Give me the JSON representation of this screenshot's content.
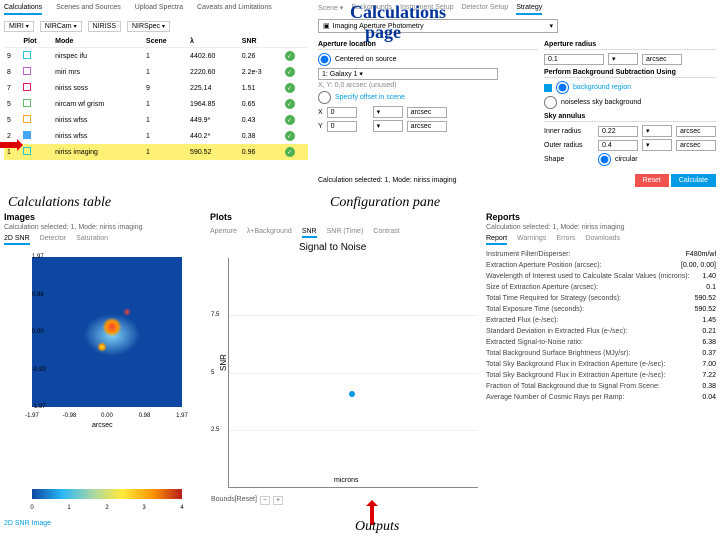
{
  "annotations": {
    "title": "Calculations",
    "page": "page",
    "calc_table": "Calculations table",
    "config": "Configuration pane",
    "outputs": "Outputs"
  },
  "calc_tabs": [
    "Calculations",
    "Scenes and Sources",
    "Upload Spectra",
    "Caveats and Limitations"
  ],
  "tools": {
    "miri": "MIRI",
    "nircam": "NIRCam",
    "niriss": "NIRISS",
    "nirspec": "NIRSpec"
  },
  "calc_table": {
    "headers": [
      "",
      "Plot",
      "Mode",
      "Scene",
      "λ",
      "SNR",
      ""
    ],
    "rows": [
      {
        "id": "9",
        "mode": "nirspec ifu",
        "scene": "1",
        "lambda": "4402.60",
        "snr": "0.26"
      },
      {
        "id": "8",
        "mode": "miri mrs",
        "scene": "1",
        "lambda": "2220.60",
        "snr": "2.2e-3"
      },
      {
        "id": "7",
        "mode": "niriss soss",
        "scene": "9",
        "lambda": "225.14",
        "snr": "1.51"
      },
      {
        "id": "5",
        "mode": "nircam wf grism",
        "scene": "1",
        "lambda": "1964.85",
        "snr": "0.65"
      },
      {
        "id": "5",
        "mode": "niriss wfss",
        "scene": "1",
        "lambda": "449.9*",
        "snr": "0.43"
      },
      {
        "id": "2",
        "mode": "niriss wfss",
        "scene": "1",
        "lambda": "440.2*",
        "snr": "0.38"
      },
      {
        "id": "1",
        "mode": "niriss imaging",
        "scene": "1",
        "lambda": "590.52",
        "snr": "0.96",
        "selected": true
      }
    ]
  },
  "config_tabs": [
    "Scene ▾",
    "Backgrounds",
    "Instrument Setup",
    "Detector Setup",
    "Strategy"
  ],
  "config": {
    "scene_mode": "Imaging Aperture Photometry",
    "aperture_loc": "Aperture location",
    "centered": "Centered on source",
    "target": "1: Galaxy 1",
    "xy": "X, Y: 0,0 arcsec (unused)",
    "spec_offset": "Specify offset in scene",
    "x_lab": "X",
    "y_lab": "Y",
    "x_val": "0",
    "y_val": "0",
    "arcsec": "arcsec",
    "ap_radius": "Aperture radius",
    "ap_radius_val": "0.1",
    "bg_sub": "Perform Background Subtraction Using",
    "bg_region": "background region",
    "noiseless": "noiseless sky background",
    "sky_ann": "Sky annulus",
    "inner": "Inner radius",
    "inner_val": "0.22",
    "outer": "Outer radius",
    "outer_val": "0.4",
    "shape": "Shape",
    "shape_val": "circular",
    "footer_sel": "Calculation selected: 1, Mode: niriss imaging",
    "reset": "Reset",
    "calculate": "Calculate"
  },
  "images": {
    "title": "Images",
    "sub": "Calculation selected: 1, Mode: niriss imaging",
    "tabs": [
      "2D SNR",
      "Detector",
      "Saturation"
    ],
    "caption": "2D SNR Image",
    "yticks": [
      "1.97",
      "0.98",
      "0.00",
      "-0.93",
      "-1.97"
    ],
    "xticks": [
      "-1.97",
      "-0.98",
      "0.00",
      "0.98",
      "1.97"
    ],
    "ylabel": "arcsec",
    "xlabel": "arcsec",
    "cbticks": [
      "0",
      "1",
      "2",
      "3",
      "4"
    ]
  },
  "plots": {
    "title": "Plots",
    "tabs": [
      "Aperture",
      "λ+Background",
      "SNR",
      "SNR (Time)",
      "Contrast"
    ],
    "chart_title": "Signal to Noise",
    "ylabel": "SNR",
    "yticks": [
      "7.5",
      "5",
      "2.5"
    ],
    "bounds": "Bounds[Reset]",
    "microns": "microns"
  },
  "reports": {
    "title": "Reports",
    "sub": "Calculation selected: 1, Mode: niriss imaging",
    "tabs": [
      "Report",
      "Warnings",
      "Errors",
      "Downloads"
    ],
    "rows": [
      {
        "lab": "Instrument Filter/Disperser:",
        "val": "F480m/wl"
      },
      {
        "lab": "Extraction Aperture Position (arcsec):",
        "val": "[0.00, 0.00]"
      },
      {
        "lab": "Wavelength of Interest used to Calculate Scalar Values (microns):",
        "val": "1.40"
      },
      {
        "lab": "Size of Extraction Aperture (arcsec):",
        "val": "0.1"
      },
      {
        "lab": "Total Time Required for Strategy (seconds):",
        "val": "590.52"
      },
      {
        "lab": "Total Exposure Time (seconds):",
        "val": "590.52"
      },
      {
        "lab": "Extracted Flux (e-/sec):",
        "val": "1.45"
      },
      {
        "lab": "Standard Deviation in Extracted Flux (e-/sec):",
        "val": "0.21"
      },
      {
        "lab": "Extracted Signal-to-Noise ratio:",
        "val": "6.38"
      },
      {
        "lab": "Total Background Surface Brightness (MJy/sr):",
        "val": "0.37"
      },
      {
        "lab": "Total Sky Background Flux in Extraction Aperture (e-/sec):",
        "val": "7.00"
      },
      {
        "lab": "Total Sky Background Flux in Extraction Aperture (e-/sec):",
        "val": "7.22"
      },
      {
        "lab": "Fraction of Total Background due to Signal From Scene:",
        "val": "0.38"
      },
      {
        "lab": "Average Number of Cosmic Rays per Ramp:",
        "val": "0.04"
      }
    ]
  },
  "chart_data": {
    "type": "scatter",
    "title": "Signal to Noise",
    "ylabel": "SNR",
    "xlabel": "microns",
    "ylim": [
      0,
      10
    ],
    "series": [
      {
        "name": "SNR",
        "x": [
          1.4
        ],
        "y": [
          4.2
        ]
      }
    ]
  }
}
